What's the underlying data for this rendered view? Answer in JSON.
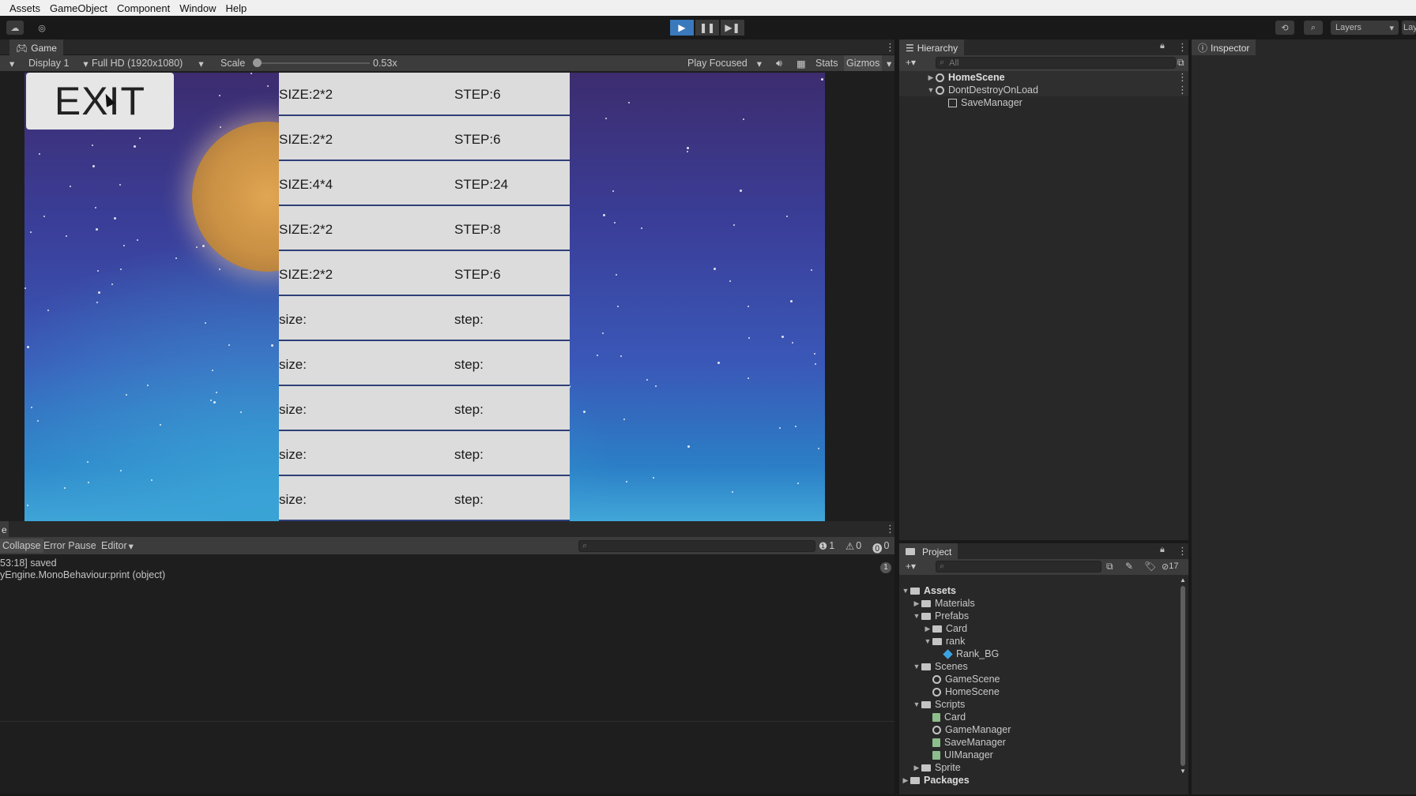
{
  "menubar": {
    "items": [
      "Assets",
      "GameObject",
      "Component",
      "Window",
      "Help"
    ]
  },
  "toolbar": {
    "layers_label": "Layers",
    "layout_label": "Lay"
  },
  "game": {
    "tab_label": "Game",
    "display_label": "Display 1",
    "resolution_label": "Full HD (1920x1080)",
    "scale_label": "Scale",
    "scale_value": "0.53x",
    "scale_level": 0.0,
    "play_focused_label": "Play Focused",
    "stats_label": "Stats",
    "gizmos_label": "Gizmos",
    "exit_label": "EXIT",
    "rows": [
      {
        "size": "SIZE:2*2",
        "step": "STEP:6"
      },
      {
        "size": "SIZE:2*2",
        "step": "STEP:6"
      },
      {
        "size": "SIZE:4*4",
        "step": "STEP:24"
      },
      {
        "size": "SIZE:2*2",
        "step": "STEP:8"
      },
      {
        "size": "SIZE:2*2",
        "step": "STEP:6"
      },
      {
        "size": "size:",
        "step": "step:"
      },
      {
        "size": "size:",
        "step": "step:"
      },
      {
        "size": "size:",
        "step": "step:"
      },
      {
        "size": "size:",
        "step": "step:"
      },
      {
        "size": "size:",
        "step": "step:"
      }
    ]
  },
  "console": {
    "tab_label": "e",
    "collapse_label": "Collapse",
    "error_pause_label": "Error Pause",
    "editor_label": "Editor",
    "info_count": "1",
    "warn_count": "0",
    "error_count": "0",
    "log_line1": "53:18] saved",
    "log_line2": "yEngine.MonoBehaviour:print (object)",
    "log_badge": "1"
  },
  "hierarchy": {
    "tab_label": "Hierarchy",
    "search_placeholder": "All",
    "items": [
      "HomeScene",
      "DontDestroyOnLoad",
      "SaveManager"
    ]
  },
  "inspector": {
    "tab_label": "Inspector"
  },
  "project": {
    "tab_label": "Project",
    "hidden_count": "17",
    "tree": [
      {
        "label": "Assets"
      },
      {
        "label": "Materials"
      },
      {
        "label": "Prefabs"
      },
      {
        "label": "Card"
      },
      {
        "label": "rank"
      },
      {
        "label": "Rank_BG"
      },
      {
        "label": "Scenes"
      },
      {
        "label": "GameScene"
      },
      {
        "label": "HomeScene"
      },
      {
        "label": "Scripts"
      },
      {
        "label": "Card"
      },
      {
        "label": "GameManager"
      },
      {
        "label": "SaveManager"
      },
      {
        "label": "UIManager"
      },
      {
        "label": "Sprite"
      },
      {
        "label": "Packages"
      }
    ]
  },
  "colors": {
    "accent_play": "#3a79bb",
    "panel_bg": "#282828",
    "toolbar_bg": "#3c3c3c"
  }
}
